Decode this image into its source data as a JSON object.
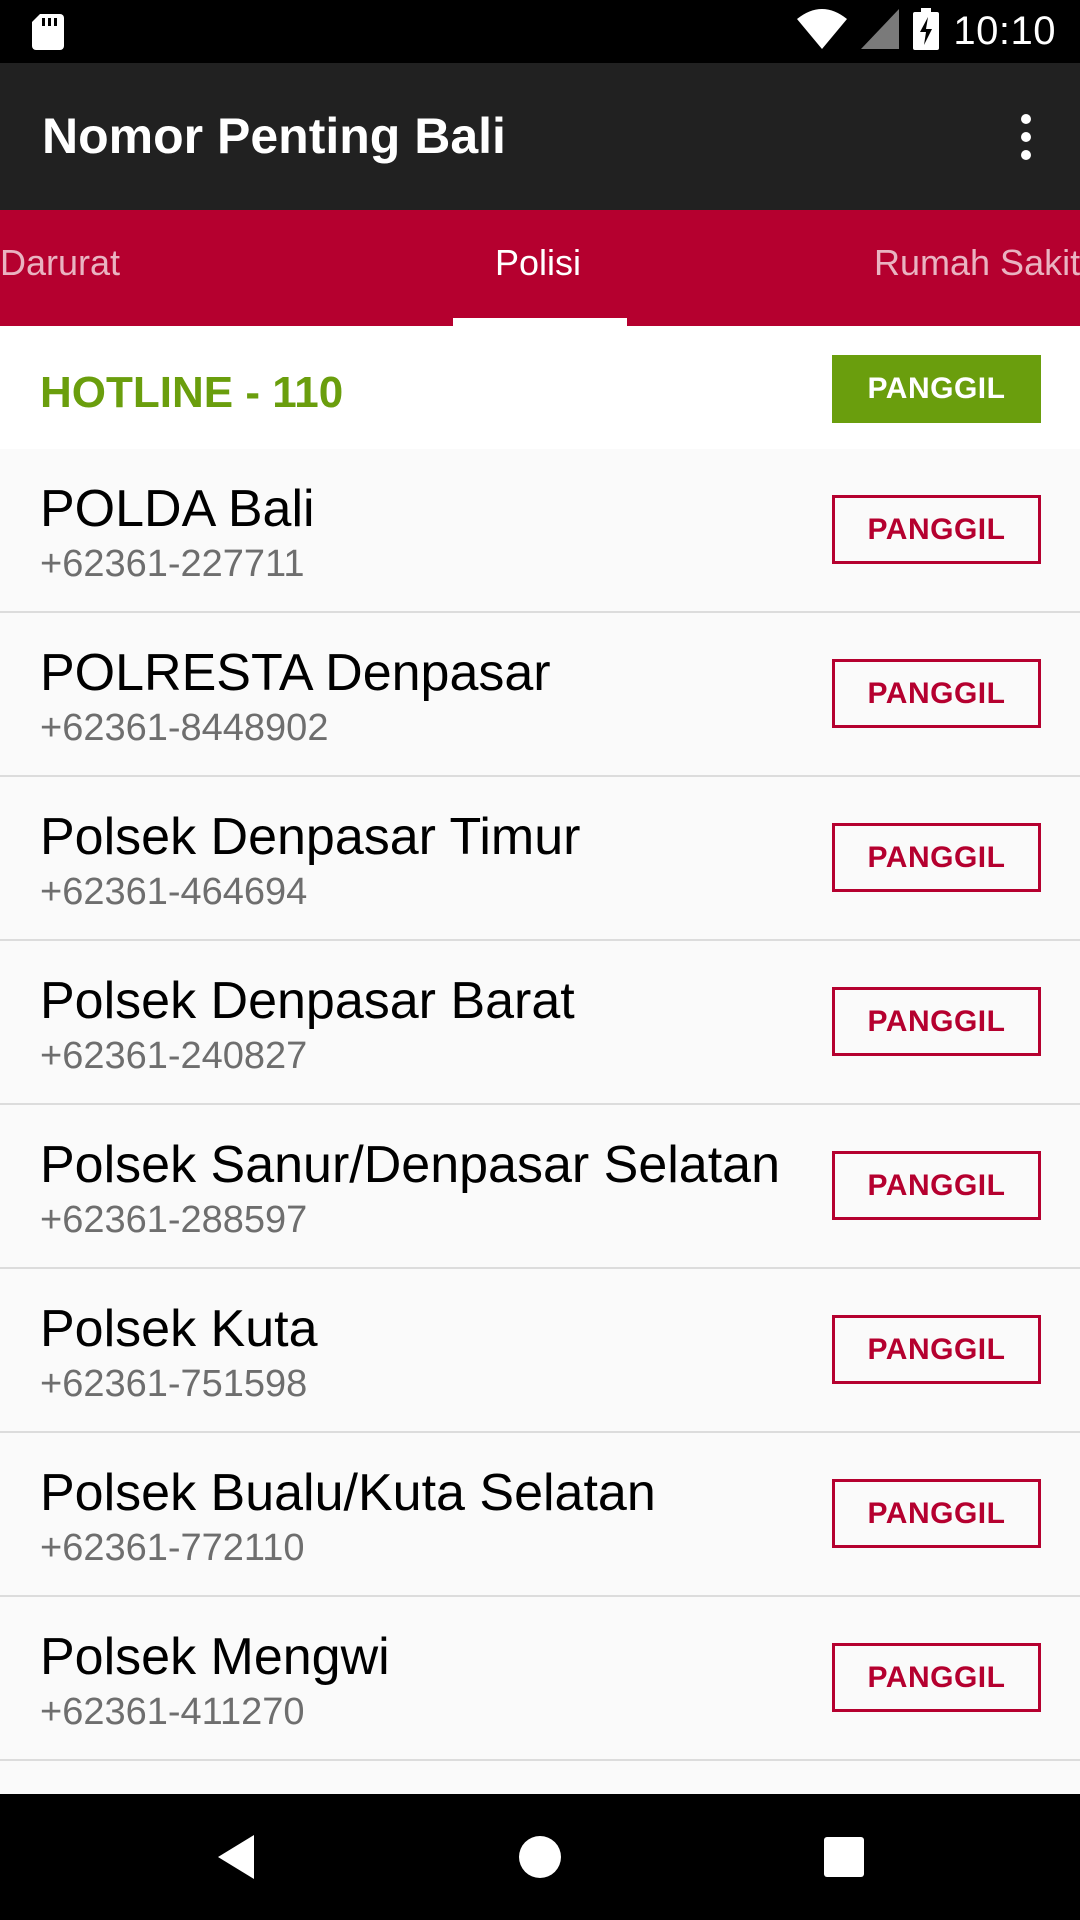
{
  "status_bar": {
    "time": "10:10",
    "icons": [
      "sd-card-icon",
      "wifi-icon",
      "signal-icon",
      "battery-charging-icon"
    ]
  },
  "app_bar": {
    "title": "Nomor Penting Bali",
    "menu_icon": "more-vert-icon"
  },
  "tabs": [
    {
      "label": "Darurat",
      "active": false
    },
    {
      "label": "Polisi",
      "active": true
    },
    {
      "label": "Rumah Sakit",
      "active": false
    }
  ],
  "hotline": {
    "label": "HOTLINE - 110",
    "button": "PANGGIL"
  },
  "contacts": [
    {
      "name": "POLDA Bali",
      "phone": "+62361-227711",
      "button": "PANGGIL"
    },
    {
      "name": "POLRESTA Denpasar",
      "phone": "+62361-8448902",
      "button": "PANGGIL"
    },
    {
      "name": "Polsek Denpasar Timur",
      "phone": "+62361-464694",
      "button": "PANGGIL"
    },
    {
      "name": "Polsek Denpasar Barat",
      "phone": "+62361-240827",
      "button": "PANGGIL"
    },
    {
      "name": "Polsek Sanur/Denpasar Selatan",
      "phone": "+62361-288597",
      "button": "PANGGIL"
    },
    {
      "name": "Polsek Kuta",
      "phone": "+62361-751598",
      "button": "PANGGIL"
    },
    {
      "name": "Polsek Bualu/Kuta Selatan",
      "phone": "+62361-772110",
      "button": "PANGGIL"
    },
    {
      "name": "Polsek Mengwi",
      "phone": "+62361-411270",
      "button": "PANGGIL"
    }
  ],
  "nav_bar": {
    "icons": [
      "back-icon",
      "home-icon",
      "recents-icon"
    ]
  },
  "colors": {
    "primary": "#b5002f",
    "toolbar": "#212121",
    "hotline_green": "#6a9e0d"
  }
}
